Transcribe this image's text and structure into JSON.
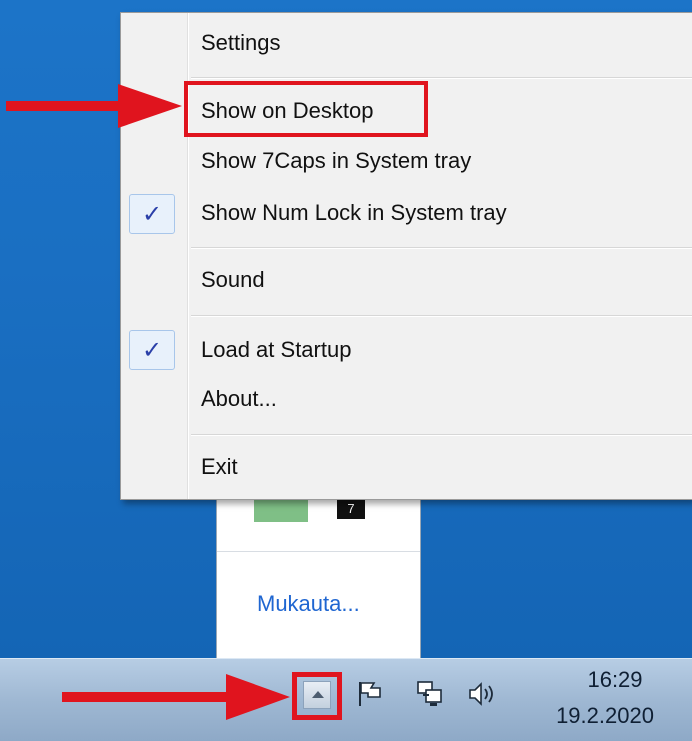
{
  "menu": {
    "items": [
      {
        "label": "Settings",
        "checked": false
      },
      {
        "label": "Show on Desktop",
        "checked": false,
        "highlighted": true
      },
      {
        "label": "Show 7Caps in System tray",
        "checked": false
      },
      {
        "label": "Show Num Lock in System tray",
        "checked": true
      },
      {
        "label": "Sound",
        "checked": false
      },
      {
        "label": "Load at Startup",
        "checked": true
      },
      {
        "label": "About...",
        "checked": false
      },
      {
        "label": "Exit",
        "checked": false
      }
    ],
    "check_glyph": "✓"
  },
  "tray_popup": {
    "seven_icon_text": "7",
    "customize_label": "Mukauta..."
  },
  "clock": {
    "time": "16:29",
    "date": "19.2.2020"
  },
  "icons": {
    "flag": "action-center-flag-icon",
    "network": "network-icon",
    "volume": "volume-icon"
  },
  "colors": {
    "annotation_red": "#e0141e",
    "desktop_blue": "#1a6fc2",
    "check_blue": "#2a3fa8"
  }
}
